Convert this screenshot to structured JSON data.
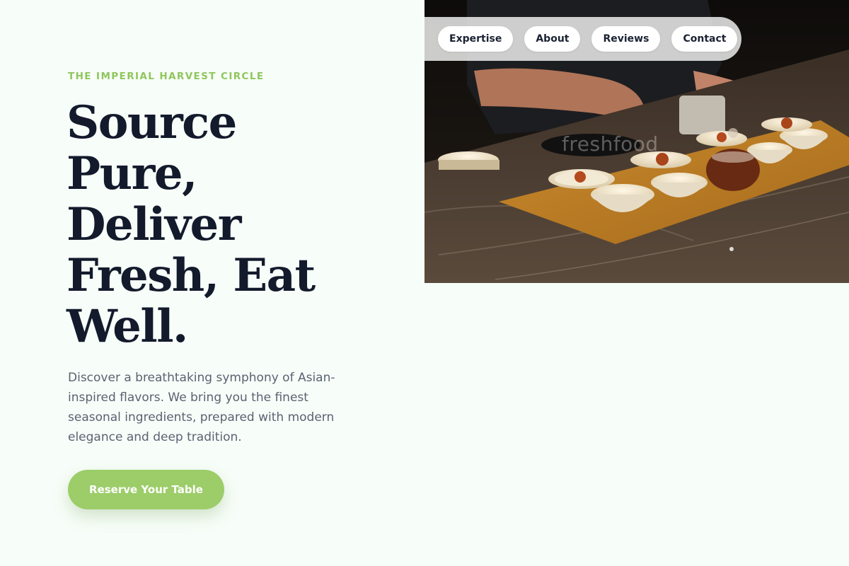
{
  "nav": {
    "items": [
      {
        "label": "Expertise"
      },
      {
        "label": "About"
      },
      {
        "label": "Reviews"
      },
      {
        "label": "Contact"
      }
    ]
  },
  "hero": {
    "eyebrow": "THE IMPERIAL HARVEST CIRCLE",
    "headline_lines": [
      "Source",
      "Pure,",
      "Deliver",
      "Fresh, Eat",
      "Well."
    ],
    "description": "Discover a breathtaking symphony of Asian-inspired flavors. We bring you the finest seasonal ingredients, prepared with modern elegance and deep tradition.",
    "cta_label": "Reserve Your Table",
    "image_watermark": "freshfood"
  },
  "colors": {
    "background": "#f7fdf8",
    "accent": "#9ccd69",
    "eyebrow": "#8fc65c",
    "headline": "#131a2c",
    "body_text": "#5b6272"
  }
}
